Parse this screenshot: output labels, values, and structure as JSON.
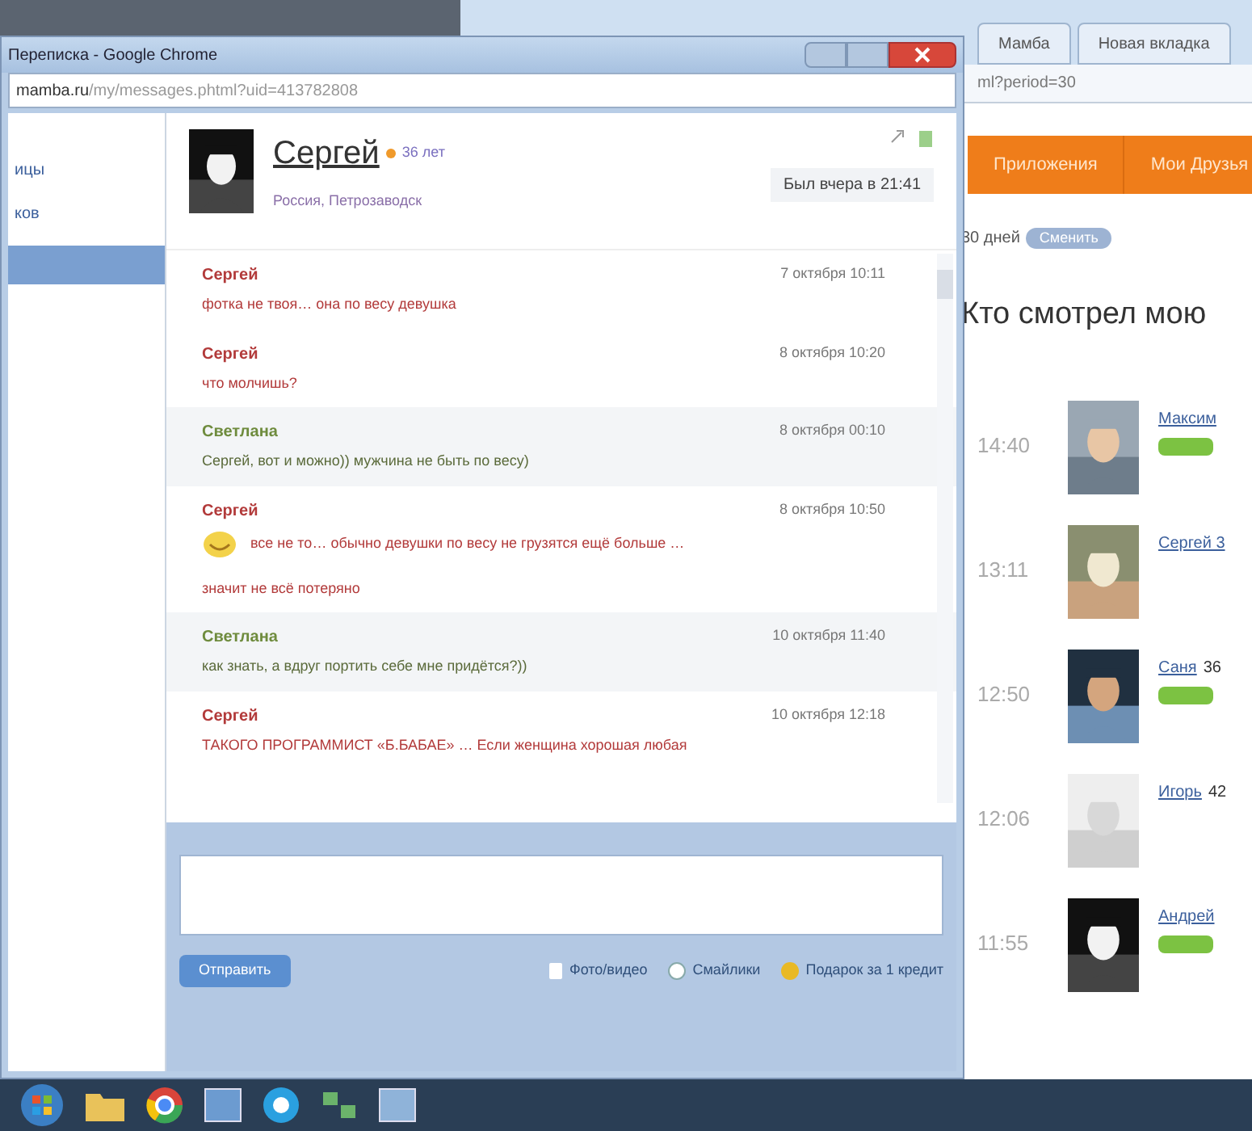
{
  "browser_back": {
    "tabs": [
      {
        "label": "Мамба"
      },
      {
        "label": "Новая вкладка"
      }
    ],
    "address": "ml?period=30",
    "nav": [
      {
        "label": "Приложения"
      },
      {
        "label": "Мои Друзья"
      }
    ],
    "period": "30 дней",
    "period_button": "Сменить",
    "heading": "Кто смотрел мою",
    "visitors": [
      {
        "time": "14:40",
        "name": "Максим",
        "online": true
      },
      {
        "time": "13:11",
        "name": "Сергей 3",
        "online": false
      },
      {
        "time": "12:50",
        "name": "Саня",
        "age": "36",
        "online": true
      },
      {
        "time": "12:06",
        "name": "Игорь",
        "age": "42",
        "online": false
      },
      {
        "time": "11:55",
        "name": "Андрей",
        "online": true
      }
    ]
  },
  "chat_window": {
    "title": "Переписка - Google Chrome",
    "address_host": "mamba.ru",
    "address_path": "/my/messages.phtml?uid=413782808",
    "sidebar": [
      {
        "label": "ицы",
        "selected": false
      },
      {
        "label": "ков",
        "selected": false
      },
      {
        "selected": true
      }
    ],
    "contact": {
      "name": "Сергей",
      "age": "36 лет",
      "location": "Россия, Петрозаводск",
      "last_seen": "Был вчера в 21:41"
    },
    "messages": [
      {
        "kind": "sent",
        "author": "Сергей",
        "date": "7 октября 10:11",
        "text": "фотка не твоя… она по весу девушка",
        "smiley": false
      },
      {
        "kind": "sent",
        "author": "Сергей",
        "date": "8 октября 10:20",
        "text": "что молчишь?",
        "smiley": false
      },
      {
        "kind": "received",
        "author": "Светлана",
        "date": "8 октября 00:10",
        "text": "Сергей, вот и можно)) мужчина не быть по весу)",
        "smiley": false
      },
      {
        "kind": "sent",
        "author": "Сергей",
        "date": "8 октября 10:50",
        "text": "все не то… обычно девушки по весу не грузятся ещё больше …",
        "smiley": true,
        "text_2": "значит не всё потеряно"
      },
      {
        "kind": "received",
        "author": "Светлана",
        "date": "10 октября 11:40",
        "text": "как знать, а вдруг портить себе мне придётся?))",
        "smiley": false
      },
      {
        "kind": "sent",
        "author": "Сергей",
        "date": "10 октября 12:18",
        "text": "ТАКОГО ПРОГРАММИСТ «Б.БАБАЕ» … Если женщина хорошая любая",
        "smiley": false
      }
    ],
    "send_button": "Отправить",
    "tools": [
      {
        "label": "Фото/видео"
      },
      {
        "kind": "smiley",
        "label": "Смайлики"
      },
      {
        "kind": "gift",
        "label": "Подарок за 1 кредит"
      }
    ]
  }
}
